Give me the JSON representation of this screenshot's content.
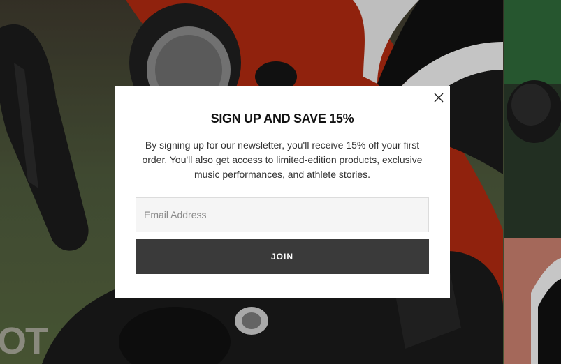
{
  "background": {
    "caption": "OT"
  },
  "modal": {
    "close_icon": "close-icon",
    "title": "SIGN UP AND SAVE 15%",
    "body": "By signing up for our newsletter, you'll receive 15% off your first order. You'll also get access to limited-edition products, exclusive music performances, and athlete stories.",
    "email_placeholder": "Email Address",
    "email_value": "",
    "join_label": "JOIN"
  },
  "colors": {
    "button": "#3a3a3a",
    "input_bg": "#f5f5f5",
    "modal_bg": "#ffffff"
  }
}
